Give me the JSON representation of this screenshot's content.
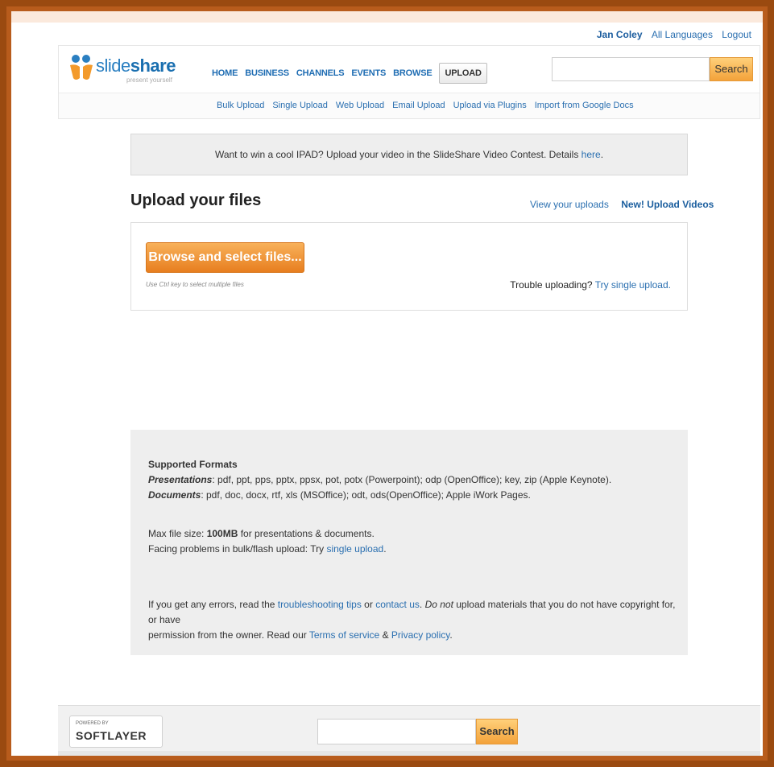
{
  "user_links": {
    "user": "Jan Coley",
    "languages": "All Languages",
    "logout": "Logout"
  },
  "header": {
    "logo_word_a": "slide",
    "logo_word_b": "share",
    "logo_tag": "present yourself",
    "nav": [
      "HOME",
      "BUSINESS",
      "CHANNELS",
      "EVENTS",
      "BROWSE",
      "UPLOAD"
    ],
    "search_placeholder": "",
    "search_label": "Search"
  },
  "subnav": [
    "Bulk Upload",
    "Single Upload",
    "Web Upload",
    "Email Upload",
    "Upload via Plugins",
    "Import from Google Docs"
  ],
  "contest": {
    "text": "Want to win a cool IPAD? Upload your video in the SlideShare Video Contest. Details ",
    "link": "here",
    "end": "."
  },
  "upload": {
    "title": "Upload your files",
    "view_uploads": "View your uploads",
    "new_upload_videos": "New! Upload Videos",
    "browse_label": "Browse and select files...",
    "hint": "Use Ctrl key to select multiple files",
    "trouble_text": "Trouble uploading? ",
    "trouble_link": "Try single upload."
  },
  "info": {
    "supported_heading": "Supported Formats",
    "presentations_label": "Presentations",
    "presentations_text": ": pdf, ppt, pps, pptx, ppsx, pot, potx (Powerpoint); odp (OpenOffice); key, zip (Apple Keynote).",
    "documents_label": "Documents",
    "documents_text": ": pdf, doc, docx, rtf, xls (MSOffice); odt, ods(OpenOffice); Apple iWork Pages.",
    "max_size_pre": "Max file size: ",
    "max_size_value": "100MB",
    "max_size_post": " for presentations & documents.",
    "facing_text": "Facing problems in bulk/flash upload: Try ",
    "facing_link": "single upload",
    "facing_end": ".",
    "errors_1": "If you get any errors, read the ",
    "errors_link1": "troubleshooting tips",
    "errors_2": " or ",
    "errors_link2": "contact us",
    "errors_3": ". ",
    "errors_italic": "Do not",
    "errors_4": " upload materials that you do not have copyright for, or have",
    "errors_5": "permission from the owner. Read our ",
    "errors_link3": "Terms of service",
    "errors_6": " & ",
    "errors_link4": "Privacy policy",
    "errors_7": "."
  },
  "footer": {
    "powered_by": "POWERED BY",
    "softlayer": "SOFTLAYER",
    "search_label": "Search"
  },
  "colors": {
    "outer_border": "#9a4a10",
    "link_blue": "#2a6fb0",
    "orange_button": "#e77e1f",
    "search_button": "#f3a23a"
  }
}
